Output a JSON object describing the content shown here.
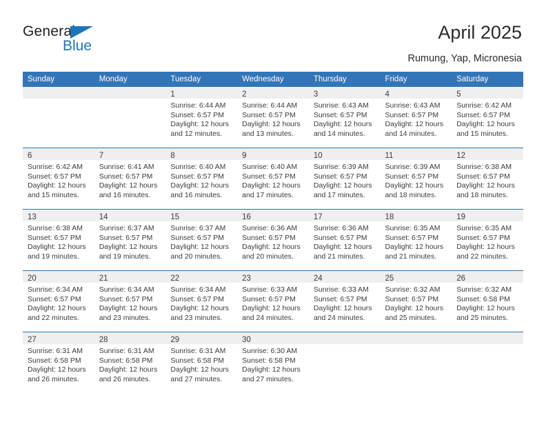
{
  "brand": {
    "name_top": "General",
    "name_bottom": "Blue",
    "color_dark": "#231f20",
    "color_blue": "#1b75bb"
  },
  "header": {
    "title": "April 2025",
    "subtitle": "Rumung, Yap, Micronesia",
    "accent_color": "#3275b8",
    "band_color": "#efefef"
  },
  "weekdays": [
    "Sunday",
    "Monday",
    "Tuesday",
    "Wednesday",
    "Thursday",
    "Friday",
    "Saturday"
  ],
  "weeks": [
    [
      {
        "day": "",
        "empty": true,
        "sunrise": "",
        "sunset": "",
        "daylight1": "",
        "daylight2": ""
      },
      {
        "day": "",
        "empty": true,
        "sunrise": "",
        "sunset": "",
        "daylight1": "",
        "daylight2": ""
      },
      {
        "day": "1",
        "empty": false,
        "sunrise": "Sunrise: 6:44 AM",
        "sunset": "Sunset: 6:57 PM",
        "daylight1": "Daylight: 12 hours",
        "daylight2": "and 12 minutes."
      },
      {
        "day": "2",
        "empty": false,
        "sunrise": "Sunrise: 6:44 AM",
        "sunset": "Sunset: 6:57 PM",
        "daylight1": "Daylight: 12 hours",
        "daylight2": "and 13 minutes."
      },
      {
        "day": "3",
        "empty": false,
        "sunrise": "Sunrise: 6:43 AM",
        "sunset": "Sunset: 6:57 PM",
        "daylight1": "Daylight: 12 hours",
        "daylight2": "and 14 minutes."
      },
      {
        "day": "4",
        "empty": false,
        "sunrise": "Sunrise: 6:43 AM",
        "sunset": "Sunset: 6:57 PM",
        "daylight1": "Daylight: 12 hours",
        "daylight2": "and 14 minutes."
      },
      {
        "day": "5",
        "empty": false,
        "sunrise": "Sunrise: 6:42 AM",
        "sunset": "Sunset: 6:57 PM",
        "daylight1": "Daylight: 12 hours",
        "daylight2": "and 15 minutes."
      }
    ],
    [
      {
        "day": "6",
        "empty": false,
        "sunrise": "Sunrise: 6:42 AM",
        "sunset": "Sunset: 6:57 PM",
        "daylight1": "Daylight: 12 hours",
        "daylight2": "and 15 minutes."
      },
      {
        "day": "7",
        "empty": false,
        "sunrise": "Sunrise: 6:41 AM",
        "sunset": "Sunset: 6:57 PM",
        "daylight1": "Daylight: 12 hours",
        "daylight2": "and 16 minutes."
      },
      {
        "day": "8",
        "empty": false,
        "sunrise": "Sunrise: 6:40 AM",
        "sunset": "Sunset: 6:57 PM",
        "daylight1": "Daylight: 12 hours",
        "daylight2": "and 16 minutes."
      },
      {
        "day": "9",
        "empty": false,
        "sunrise": "Sunrise: 6:40 AM",
        "sunset": "Sunset: 6:57 PM",
        "daylight1": "Daylight: 12 hours",
        "daylight2": "and 17 minutes."
      },
      {
        "day": "10",
        "empty": false,
        "sunrise": "Sunrise: 6:39 AM",
        "sunset": "Sunset: 6:57 PM",
        "daylight1": "Daylight: 12 hours",
        "daylight2": "and 17 minutes."
      },
      {
        "day": "11",
        "empty": false,
        "sunrise": "Sunrise: 6:39 AM",
        "sunset": "Sunset: 6:57 PM",
        "daylight1": "Daylight: 12 hours",
        "daylight2": "and 18 minutes."
      },
      {
        "day": "12",
        "empty": false,
        "sunrise": "Sunrise: 6:38 AM",
        "sunset": "Sunset: 6:57 PM",
        "daylight1": "Daylight: 12 hours",
        "daylight2": "and 18 minutes."
      }
    ],
    [
      {
        "day": "13",
        "empty": false,
        "sunrise": "Sunrise: 6:38 AM",
        "sunset": "Sunset: 6:57 PM",
        "daylight1": "Daylight: 12 hours",
        "daylight2": "and 19 minutes."
      },
      {
        "day": "14",
        "empty": false,
        "sunrise": "Sunrise: 6:37 AM",
        "sunset": "Sunset: 6:57 PM",
        "daylight1": "Daylight: 12 hours",
        "daylight2": "and 19 minutes."
      },
      {
        "day": "15",
        "empty": false,
        "sunrise": "Sunrise: 6:37 AM",
        "sunset": "Sunset: 6:57 PM",
        "daylight1": "Daylight: 12 hours",
        "daylight2": "and 20 minutes."
      },
      {
        "day": "16",
        "empty": false,
        "sunrise": "Sunrise: 6:36 AM",
        "sunset": "Sunset: 6:57 PM",
        "daylight1": "Daylight: 12 hours",
        "daylight2": "and 20 minutes."
      },
      {
        "day": "17",
        "empty": false,
        "sunrise": "Sunrise: 6:36 AM",
        "sunset": "Sunset: 6:57 PM",
        "daylight1": "Daylight: 12 hours",
        "daylight2": "and 21 minutes."
      },
      {
        "day": "18",
        "empty": false,
        "sunrise": "Sunrise: 6:35 AM",
        "sunset": "Sunset: 6:57 PM",
        "daylight1": "Daylight: 12 hours",
        "daylight2": "and 21 minutes."
      },
      {
        "day": "19",
        "empty": false,
        "sunrise": "Sunrise: 6:35 AM",
        "sunset": "Sunset: 6:57 PM",
        "daylight1": "Daylight: 12 hours",
        "daylight2": "and 22 minutes."
      }
    ],
    [
      {
        "day": "20",
        "empty": false,
        "sunrise": "Sunrise: 6:34 AM",
        "sunset": "Sunset: 6:57 PM",
        "daylight1": "Daylight: 12 hours",
        "daylight2": "and 22 minutes."
      },
      {
        "day": "21",
        "empty": false,
        "sunrise": "Sunrise: 6:34 AM",
        "sunset": "Sunset: 6:57 PM",
        "daylight1": "Daylight: 12 hours",
        "daylight2": "and 23 minutes."
      },
      {
        "day": "22",
        "empty": false,
        "sunrise": "Sunrise: 6:34 AM",
        "sunset": "Sunset: 6:57 PM",
        "daylight1": "Daylight: 12 hours",
        "daylight2": "and 23 minutes."
      },
      {
        "day": "23",
        "empty": false,
        "sunrise": "Sunrise: 6:33 AM",
        "sunset": "Sunset: 6:57 PM",
        "daylight1": "Daylight: 12 hours",
        "daylight2": "and 24 minutes."
      },
      {
        "day": "24",
        "empty": false,
        "sunrise": "Sunrise: 6:33 AM",
        "sunset": "Sunset: 6:57 PM",
        "daylight1": "Daylight: 12 hours",
        "daylight2": "and 24 minutes."
      },
      {
        "day": "25",
        "empty": false,
        "sunrise": "Sunrise: 6:32 AM",
        "sunset": "Sunset: 6:57 PM",
        "daylight1": "Daylight: 12 hours",
        "daylight2": "and 25 minutes."
      },
      {
        "day": "26",
        "empty": false,
        "sunrise": "Sunrise: 6:32 AM",
        "sunset": "Sunset: 6:58 PM",
        "daylight1": "Daylight: 12 hours",
        "daylight2": "and 25 minutes."
      }
    ],
    [
      {
        "day": "27",
        "empty": false,
        "sunrise": "Sunrise: 6:31 AM",
        "sunset": "Sunset: 6:58 PM",
        "daylight1": "Daylight: 12 hours",
        "daylight2": "and 26 minutes."
      },
      {
        "day": "28",
        "empty": false,
        "sunrise": "Sunrise: 6:31 AM",
        "sunset": "Sunset: 6:58 PM",
        "daylight1": "Daylight: 12 hours",
        "daylight2": "and 26 minutes."
      },
      {
        "day": "29",
        "empty": false,
        "sunrise": "Sunrise: 6:31 AM",
        "sunset": "Sunset: 6:58 PM",
        "daylight1": "Daylight: 12 hours",
        "daylight2": "and 27 minutes."
      },
      {
        "day": "30",
        "empty": false,
        "sunrise": "Sunrise: 6:30 AM",
        "sunset": "Sunset: 6:58 PM",
        "daylight1": "Daylight: 12 hours",
        "daylight2": "and 27 minutes."
      },
      {
        "day": "",
        "empty": true,
        "sunrise": "",
        "sunset": "",
        "daylight1": "",
        "daylight2": ""
      },
      {
        "day": "",
        "empty": true,
        "sunrise": "",
        "sunset": "",
        "daylight1": "",
        "daylight2": ""
      },
      {
        "day": "",
        "empty": true,
        "sunrise": "",
        "sunset": "",
        "daylight1": "",
        "daylight2": ""
      }
    ]
  ]
}
